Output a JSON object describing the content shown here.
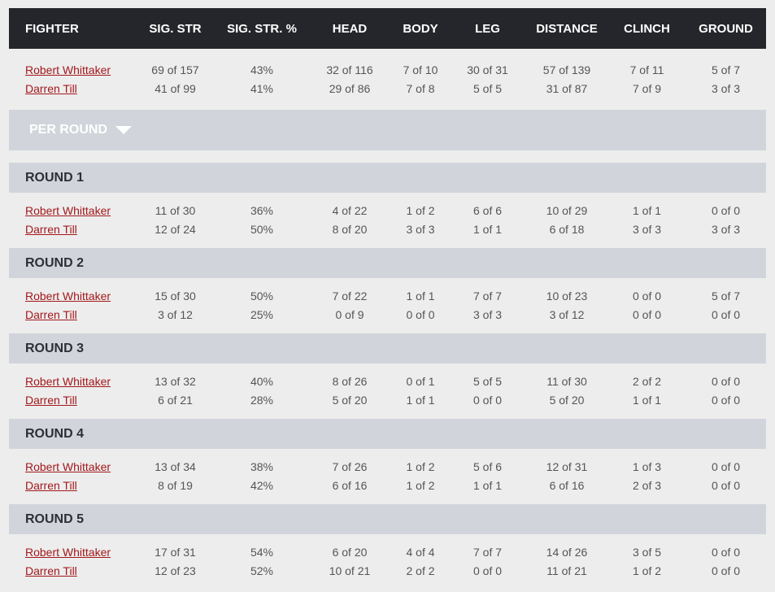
{
  "headers": [
    "FIGHTER",
    "SIG. STR",
    "SIG. STR. %",
    "HEAD",
    "BODY",
    "LEG",
    "DISTANCE",
    "CLINCH",
    "GROUND"
  ],
  "fighters": [
    "Robert Whittaker",
    "Darren Till"
  ],
  "totals": [
    [
      "69 of 157",
      "43%",
      "32 of 116",
      "7 of 10",
      "30 of 31",
      "57 of 139",
      "7 of 11",
      "5 of 7"
    ],
    [
      "41 of 99",
      "41%",
      "29 of 86",
      "7 of 8",
      "5 of 5",
      "31 of 87",
      "7 of 9",
      "3 of 3"
    ]
  ],
  "per_round_label": "PER ROUND",
  "rounds": [
    {
      "label": "ROUND 1",
      "stats": [
        [
          "11 of 30",
          "36%",
          "4 of 22",
          "1 of 2",
          "6 of 6",
          "10 of 29",
          "1 of 1",
          "0 of 0"
        ],
        [
          "12 of 24",
          "50%",
          "8 of 20",
          "3 of 3",
          "1 of 1",
          "6 of 18",
          "3 of 3",
          "3 of 3"
        ]
      ]
    },
    {
      "label": "ROUND 2",
      "stats": [
        [
          "15 of 30",
          "50%",
          "7 of 22",
          "1 of 1",
          "7 of 7",
          "10 of 23",
          "0 of 0",
          "5 of 7"
        ],
        [
          "3 of 12",
          "25%",
          "0 of 9",
          "0 of 0",
          "3 of 3",
          "3 of 12",
          "0 of 0",
          "0 of 0"
        ]
      ]
    },
    {
      "label": "ROUND 3",
      "stats": [
        [
          "13 of 32",
          "40%",
          "8 of 26",
          "0 of 1",
          "5 of 5",
          "11 of 30",
          "2 of 2",
          "0 of 0"
        ],
        [
          "6 of 21",
          "28%",
          "5 of 20",
          "1 of 1",
          "0 of 0",
          "5 of 20",
          "1 of 1",
          "0 of 0"
        ]
      ]
    },
    {
      "label": "ROUND 4",
      "stats": [
        [
          "13 of 34",
          "38%",
          "7 of 26",
          "1 of 2",
          "5 of 6",
          "12 of 31",
          "1 of 3",
          "0 of 0"
        ],
        [
          "8 of 19",
          "42%",
          "6 of 16",
          "1 of 2",
          "1 of 1",
          "6 of 16",
          "2 of 3",
          "0 of 0"
        ]
      ]
    },
    {
      "label": "ROUND 5",
      "stats": [
        [
          "17 of 31",
          "54%",
          "6 of 20",
          "4 of 4",
          "7 of 7",
          "14 of 26",
          "3 of 5",
          "0 of 0"
        ],
        [
          "12 of 23",
          "52%",
          "10 of 21",
          "2 of 2",
          "0 of 0",
          "11 of 21",
          "1 of 2",
          "0 of 0"
        ]
      ]
    }
  ],
  "colors": {
    "header_bg": "#24262b",
    "band_bg": "#d1d5db",
    "link": "#a3181c",
    "page_bg": "#ededed"
  }
}
